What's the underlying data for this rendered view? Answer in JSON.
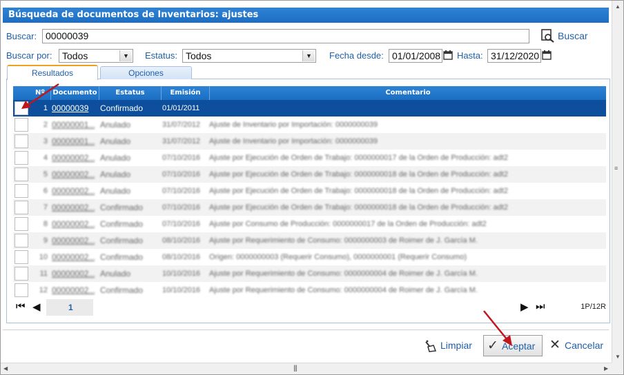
{
  "dialog": {
    "title": "Búsqueda de documentos de Inventarios: ajustes"
  },
  "search": {
    "label": "Buscar:",
    "value": "00000039",
    "button_label": "Buscar"
  },
  "filters": {
    "buscar_por_label": "Buscar por:",
    "buscar_por_value": "Todos",
    "estatus_label": "Estatus:",
    "estatus_value": "Todos",
    "fecha_desde_label": "Fecha desde:",
    "fecha_desde_value": "01/01/2008",
    "hasta_label": "Hasta:",
    "hasta_value": "31/12/2020"
  },
  "tabs": [
    {
      "label": "Resultados",
      "active": true
    },
    {
      "label": "Opciones",
      "active": false
    }
  ],
  "grid": {
    "columns": [
      "Nº",
      "Documento",
      "Estatus",
      "Emisión",
      "Comentario"
    ],
    "rows": [
      {
        "n": "1",
        "doc": "00000039",
        "estatus": "Confirmado",
        "emision": "01/01/2011",
        "comentario": ""
      },
      {
        "n": "2",
        "doc": "00000001...",
        "estatus": "Anulado",
        "emision": "31/07/2012",
        "comentario": "Ajuste de Inventario por Importación: 0000000039"
      },
      {
        "n": "3",
        "doc": "00000001...",
        "estatus": "Anulado",
        "emision": "31/07/2012",
        "comentario": "Ajuste de Inventario por Importación: 0000000039"
      },
      {
        "n": "4",
        "doc": "00000002...",
        "estatus": "Anulado",
        "emision": "07/10/2016",
        "comentario": "Ajuste por Ejecución de Orden de Trabajo: 0000000017 de la Orden de Producción: adt2"
      },
      {
        "n": "5",
        "doc": "00000002...",
        "estatus": "Anulado",
        "emision": "07/10/2016",
        "comentario": "Ajuste por Ejecución de Orden de Trabajo: 0000000018 de la Orden de Producción: adt2"
      },
      {
        "n": "6",
        "doc": "00000002...",
        "estatus": "Anulado",
        "emision": "07/10/2016",
        "comentario": "Ajuste por Ejecución de Orden de Trabajo: 0000000018 de la Orden de Producción: adt2"
      },
      {
        "n": "7",
        "doc": "00000002...",
        "estatus": "Confirmado",
        "emision": "07/10/2016",
        "comentario": "Ajuste por Ejecución de Orden de Trabajo: 0000000018 de la Orden de Producción: adt2"
      },
      {
        "n": "8",
        "doc": "00000002...",
        "estatus": "Confirmado",
        "emision": "07/10/2016",
        "comentario": "Ajuste por Consumo de Producción: 0000000017 de la Orden de Producción: adt2"
      },
      {
        "n": "9",
        "doc": "00000002...",
        "estatus": "Confirmado",
        "emision": "08/10/2016",
        "comentario": "Ajuste por Requerimiento de Consumo: 0000000003 de Roimer de J. García M."
      },
      {
        "n": "10",
        "doc": "00000002...",
        "estatus": "Confirmado",
        "emision": "08/10/2016",
        "comentario": "Origen: 0000000003 (Requerir Consumo), 0000000001 (Requerir Consumo)"
      },
      {
        "n": "11",
        "doc": "00000002...",
        "estatus": "Anulado",
        "emision": "10/10/2016",
        "comentario": "Ajuste por Requerimiento de Consumo: 0000000004 de Roimer de J. García M."
      },
      {
        "n": "12",
        "doc": "00000002...",
        "estatus": "Confirmado",
        "emision": "10/10/2016",
        "comentario": "Ajuste por Requerimiento de Consumo: 0000000004 de Roimer de J. García M."
      }
    ]
  },
  "pager": {
    "current_page": "1",
    "info": "1P/12R"
  },
  "footer": {
    "clear_label": "Limpiar",
    "accept_label": "Aceptar",
    "cancel_label": "Cancelar"
  },
  "colors": {
    "header_blue": "#1b6ec2",
    "selected_row": "#0d4f9c",
    "label_blue": "#1f5fa8",
    "annotation_red": "#c0161c"
  },
  "icons": [
    "search-icon",
    "calendar-icon",
    "first-page-icon",
    "prev-page-icon",
    "next-page-icon",
    "last-page-icon",
    "broom-icon",
    "check-icon",
    "close-icon",
    "red-arrow-annotation"
  ]
}
